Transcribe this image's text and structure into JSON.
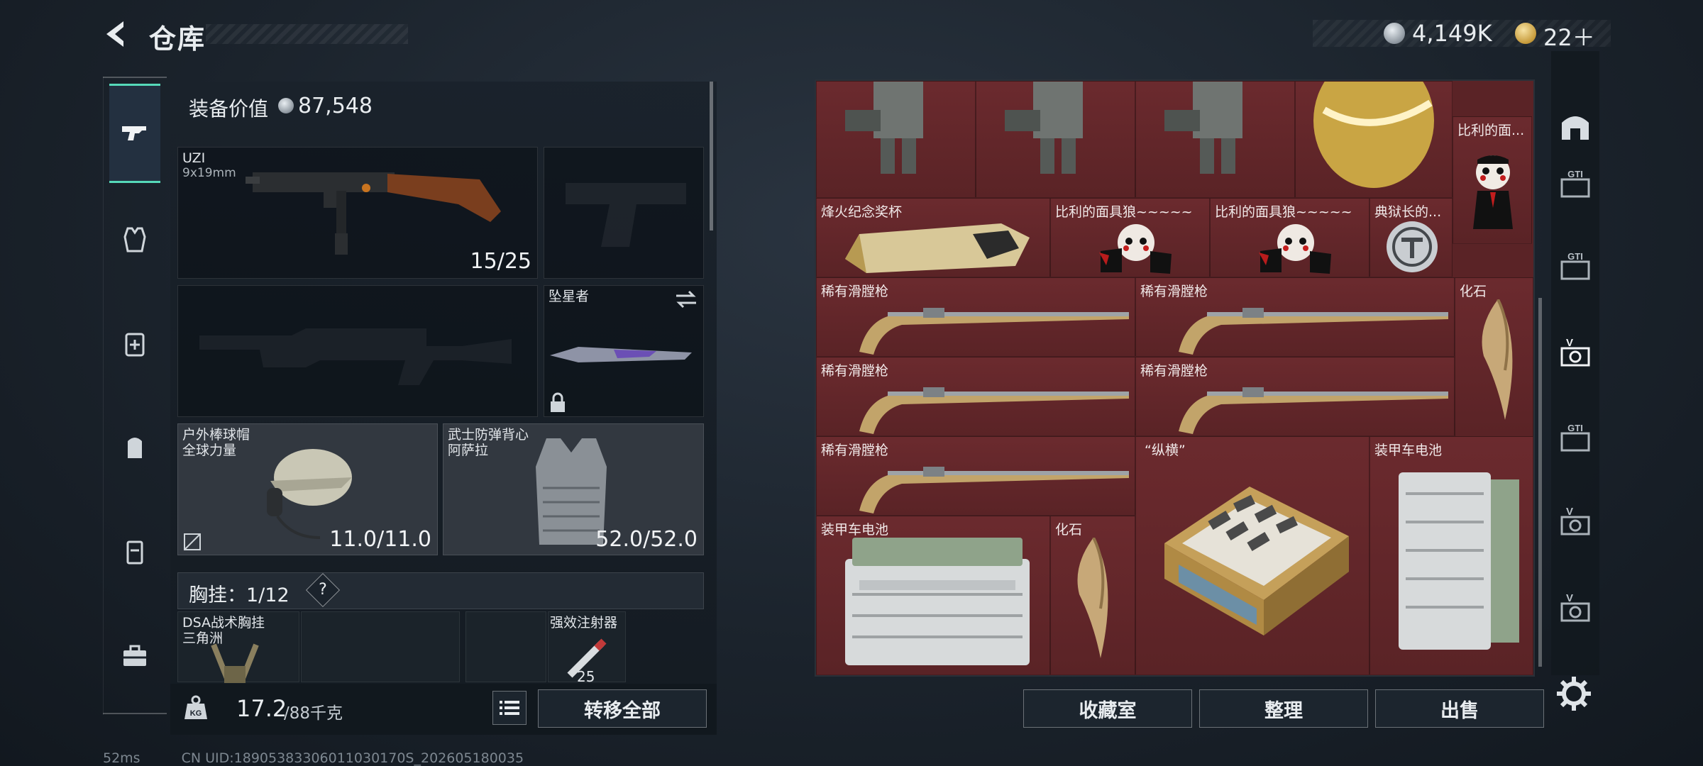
{
  "header": {
    "title": "仓库",
    "currency_silver": "4,149K",
    "currency_gold": "22＋"
  },
  "equipment": {
    "value_label": "装备价值",
    "value": "87,548",
    "uzi": {
      "name": "UZI",
      "caliber": "9x19mm",
      "ammo": "15/25"
    },
    "knife": {
      "name": "坠星者"
    },
    "helmet": {
      "name": "户外棒球帽",
      "sub": "全球力量",
      "durability": "11.0/11.0"
    },
    "vest": {
      "name": "武士防弹背心",
      "sub": "阿萨拉",
      "durability": "52.0/52.0"
    },
    "chest": {
      "label": "胸挂：",
      "count": "1/12",
      "help": "?"
    },
    "chest_items": [
      {
        "name": "DSA战术胸挂",
        "sub": "三角洲"
      },
      {
        "name": "强效注射器",
        "count": "25"
      }
    ],
    "weight": {
      "current": "17.2",
      "max": "/88千克"
    },
    "transfer_all": "转移全部"
  },
  "storage": {
    "items": {
      "trophy": "烽火纪念奖杯",
      "billy_head": "比利的面...",
      "billy_doll_1": "比利的面具狼~~~~~",
      "billy_doll_2": "比利的面具狼~~~~~",
      "warden": "典狱长的...",
      "musket": "稀有滑膛枪",
      "fossil": "化石",
      "chess": "“纵横”",
      "battery": "装甲车电池"
    }
  },
  "buttons": {
    "collection": "收藏室",
    "organize": "整理",
    "sell": "出售"
  },
  "right_nav": [
    {
      "icon": "arch-icon"
    },
    {
      "icon": "gti-icon",
      "text": "GTI"
    },
    {
      "icon": "gti-icon",
      "text": "GTI"
    },
    {
      "icon": "v-icon",
      "text": "V"
    },
    {
      "icon": "gti-icon",
      "text": "GTI"
    },
    {
      "icon": "v-icon",
      "text": "V"
    },
    {
      "icon": "v-icon",
      "text": "V"
    }
  ],
  "status": {
    "ping": "52ms",
    "uid": "CN UID:18905383306011030170S_202605180035"
  },
  "colors": {
    "accent": "#56d9b9",
    "storage_bg": "#5a2326",
    "panel_bg": "#1b232c"
  }
}
